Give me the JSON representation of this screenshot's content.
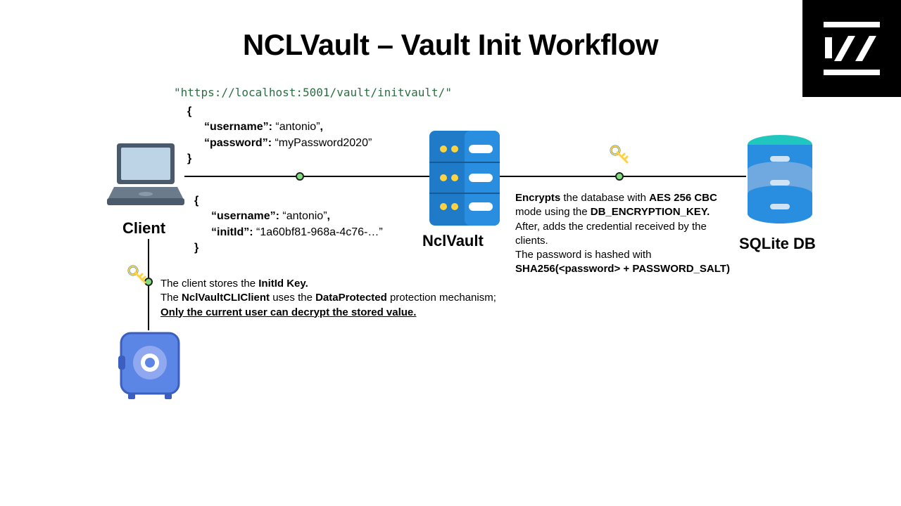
{
  "title": "NCLVault – Vault Init Workflow",
  "url": "\"https://localhost:5001/vault/initvault/\"",
  "request": {
    "open": "{",
    "k1": "username",
    "v1": "antonio",
    "k2": "password",
    "v2": "myPassword2020",
    "close": "}"
  },
  "response": {
    "open": "{",
    "k1": "username",
    "v1": "antonio",
    "k2": "initId",
    "v2": "1a60bf81-968a-4c76-…",
    "close": "}"
  },
  "labels": {
    "client": "Client",
    "vault": "NclVault",
    "db": "SQLite DB"
  },
  "db_para": {
    "t1a": "Encrypts",
    "t1b": " the database with ",
    "t1c": "AES 256 CBC",
    "t2a": "mode using the ",
    "t2b": "DB_ENCRYPTION_KEY.",
    "t3": "After, adds the credential received by the clients.",
    "t4": "The password is hashed with ",
    "t5": "SHA256(<password> + PASSWORD_SALT)"
  },
  "client_para": {
    "t1a": "The client stores the ",
    "t1b": "InitId Key.",
    "t2a": "The ",
    "t2b": "NclVaultCLIClient",
    "t2c": " uses the ",
    "t2d": "DataProtected",
    "t2e": " protection mechanism;",
    "t3": "Only the current user can decrypt the stored value."
  }
}
